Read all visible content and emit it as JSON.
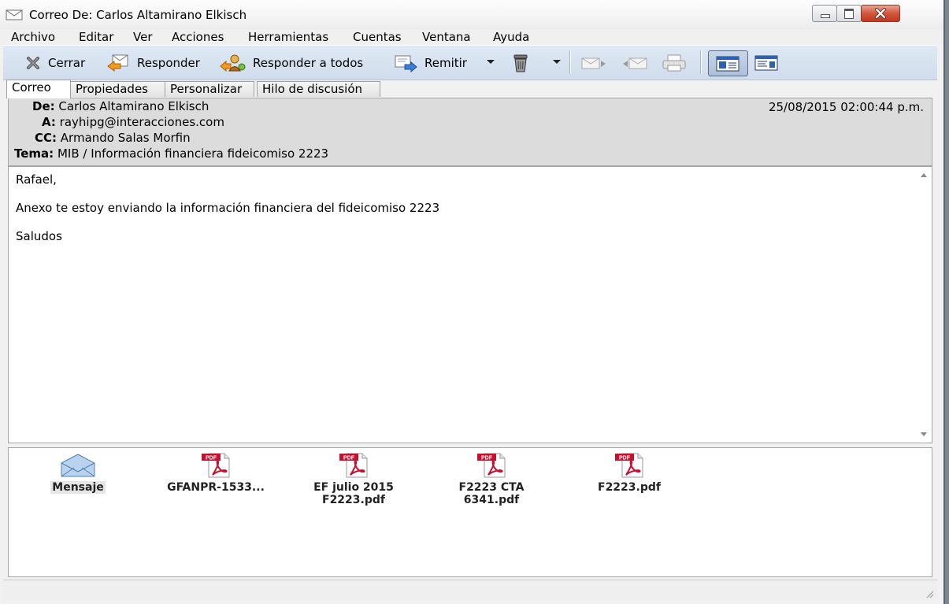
{
  "window": {
    "title": "Correo De: Carlos Altamirano Elkisch"
  },
  "menu": [
    "Archivo",
    "Editar",
    "Ver",
    "Acciones",
    "Herramientas",
    "Cuentas",
    "Ventana",
    "Ayuda"
  ],
  "toolbar": {
    "close_label": "Cerrar",
    "reply_label": "Responder",
    "reply_all_label": "Responder a todos",
    "forward_label": "Remitir"
  },
  "tabs": [
    "Correo",
    "Propiedades",
    "Personalizar",
    "Hilo de discusión"
  ],
  "header": {
    "from_label": "De:",
    "from_value": "Carlos Altamirano Elkisch",
    "to_label": "A:",
    "to_value": "rayhipg@interacciones.com",
    "cc_label": "CC:",
    "cc_value": "Armando Salas Morfin",
    "subject_label": "Tema:",
    "subject_value": "MIB / Información financiera fideicomiso 2223",
    "date": "25/08/2015 02:00:44 p.m."
  },
  "body": {
    "lines": [
      "Rafael,",
      "Anexo te estoy enviando la información financiera del fideicomiso 2223",
      "Saludos"
    ]
  },
  "attachments": [
    {
      "name": "Mensaje",
      "icon": "envelope-icon"
    },
    {
      "name": "GFANPR-1533...",
      "icon": "pdf-icon"
    },
    {
      "name": "EF julio 2015\nF2223.pdf",
      "icon": "pdf-icon"
    },
    {
      "name": "F2223 CTA\n6341.pdf",
      "icon": "pdf-icon"
    },
    {
      "name": "F2223.pdf",
      "icon": "pdf-icon"
    }
  ],
  "colors": {
    "toolbar_bg": "#d6e1ef",
    "header_bg": "#dcdcdc",
    "pdf_red": "#c8102e",
    "close_button": "#c7432a"
  }
}
